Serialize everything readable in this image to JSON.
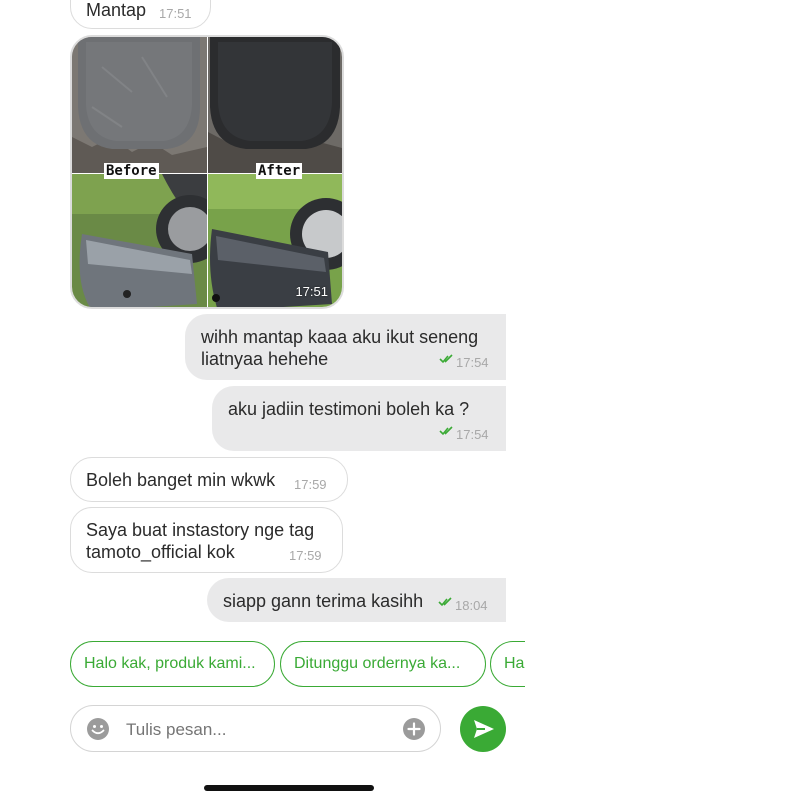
{
  "messages": [
    {
      "direction": "in",
      "text": "Mantap",
      "time": "17:51"
    },
    {
      "direction": "in",
      "type": "image",
      "labels": {
        "before": "Before",
        "after": "After"
      },
      "time": "17:51"
    },
    {
      "direction": "out",
      "lines": [
        "wihh mantap kaaa aku ikut seneng",
        "liatnyaa hehehe"
      ],
      "time": "17:54",
      "status": "read"
    },
    {
      "direction": "out",
      "text": "aku jadiin testimoni boleh ka ?",
      "time": "17:54",
      "status": "read"
    },
    {
      "direction": "in",
      "text": "Boleh banget min wkwk",
      "time": "17:59"
    },
    {
      "direction": "in",
      "lines": [
        "Saya buat instastory nge tag",
        "tamoto_official kok"
      ],
      "time": "17:59"
    },
    {
      "direction": "out",
      "text": "siapp gann terima kasihh",
      "time": "18:04",
      "status": "read"
    }
  ],
  "quick_replies": [
    "Halo kak, produk kami...",
    "Ditunggu ordernya ka...",
    "Ha"
  ],
  "composer": {
    "placeholder": "Tulis pesan...",
    "emoji_icon": "emoji-icon",
    "add_icon": "plus-circle-icon",
    "send_icon": "send-icon"
  },
  "colors": {
    "accent": "#3aaa35",
    "outgoing_bubble": "#e9e9ea",
    "incoming_border": "#dcdcdc"
  }
}
